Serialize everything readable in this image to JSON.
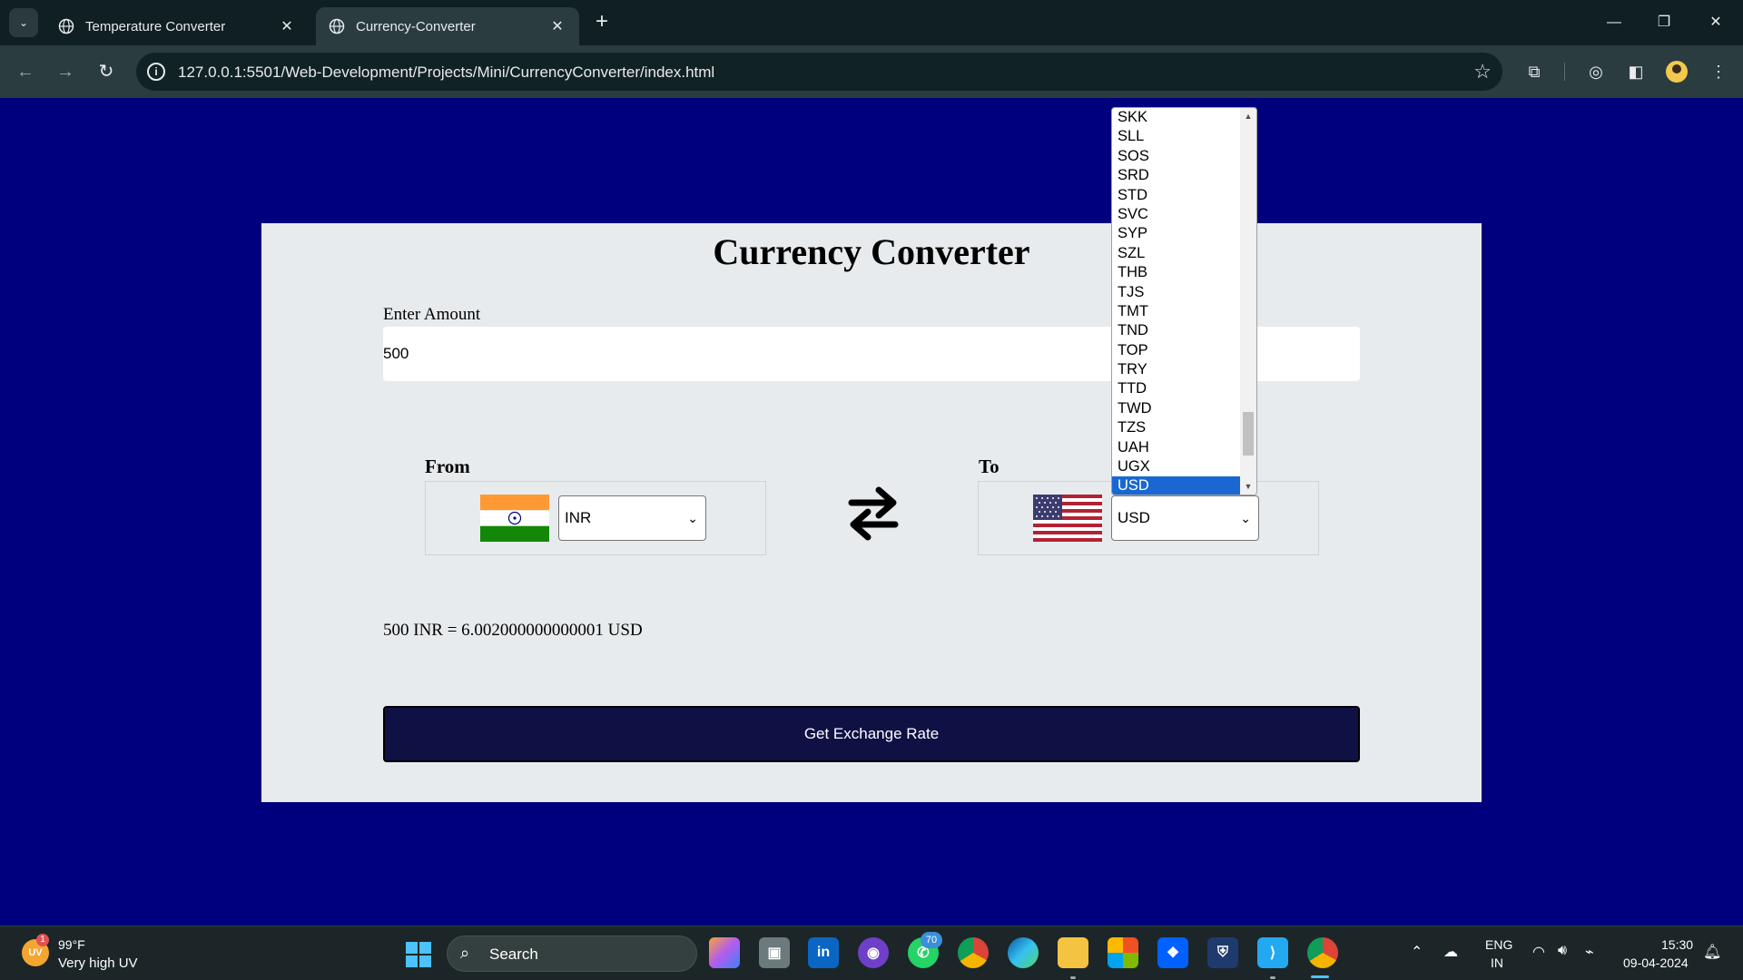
{
  "browser": {
    "tabs": [
      {
        "title": "Temperature Converter",
        "active": false
      },
      {
        "title": "Currency-Converter",
        "active": true
      }
    ],
    "new_tab_symbol": "+",
    "url": "127.0.0.1:5501/Web-Development/Projects/Mini/CurrencyConverter/index.html",
    "window_controls": {
      "minimize": "—",
      "restore": "❐",
      "close": "✕"
    }
  },
  "page": {
    "title": "Currency Converter",
    "amount_label": "Enter Amount",
    "amount_value": "500",
    "from_label": "From",
    "to_label": "To",
    "from_currency": "INR",
    "to_currency": "USD",
    "result_text": "500 INR = 6.002000000000001 USD",
    "button_label": "Get Exchange Rate"
  },
  "dropdown_open": {
    "options": [
      "SKK",
      "SLL",
      "SOS",
      "SRD",
      "STD",
      "SVC",
      "SYP",
      "SZL",
      "THB",
      "TJS",
      "TMT",
      "TND",
      "TOP",
      "TRY",
      "TTD",
      "TWD",
      "TZS",
      "UAH",
      "UGX",
      "USD"
    ],
    "selected": "USD"
  },
  "taskbar": {
    "weather_temp": "99°F",
    "weather_desc": "Very high UV",
    "weather_icon_text": "UV",
    "weather_badge": "1",
    "search_label": "Search",
    "whatsapp_badge": "70",
    "language_line1": "ENG",
    "language_line2": "IN",
    "time": "15:30",
    "date": "09-04-2024"
  },
  "colors": {
    "page_background": "#00007f",
    "card_background": "#e7ebee",
    "button_background": "#0f1145",
    "selected_option": "#1967d2"
  }
}
